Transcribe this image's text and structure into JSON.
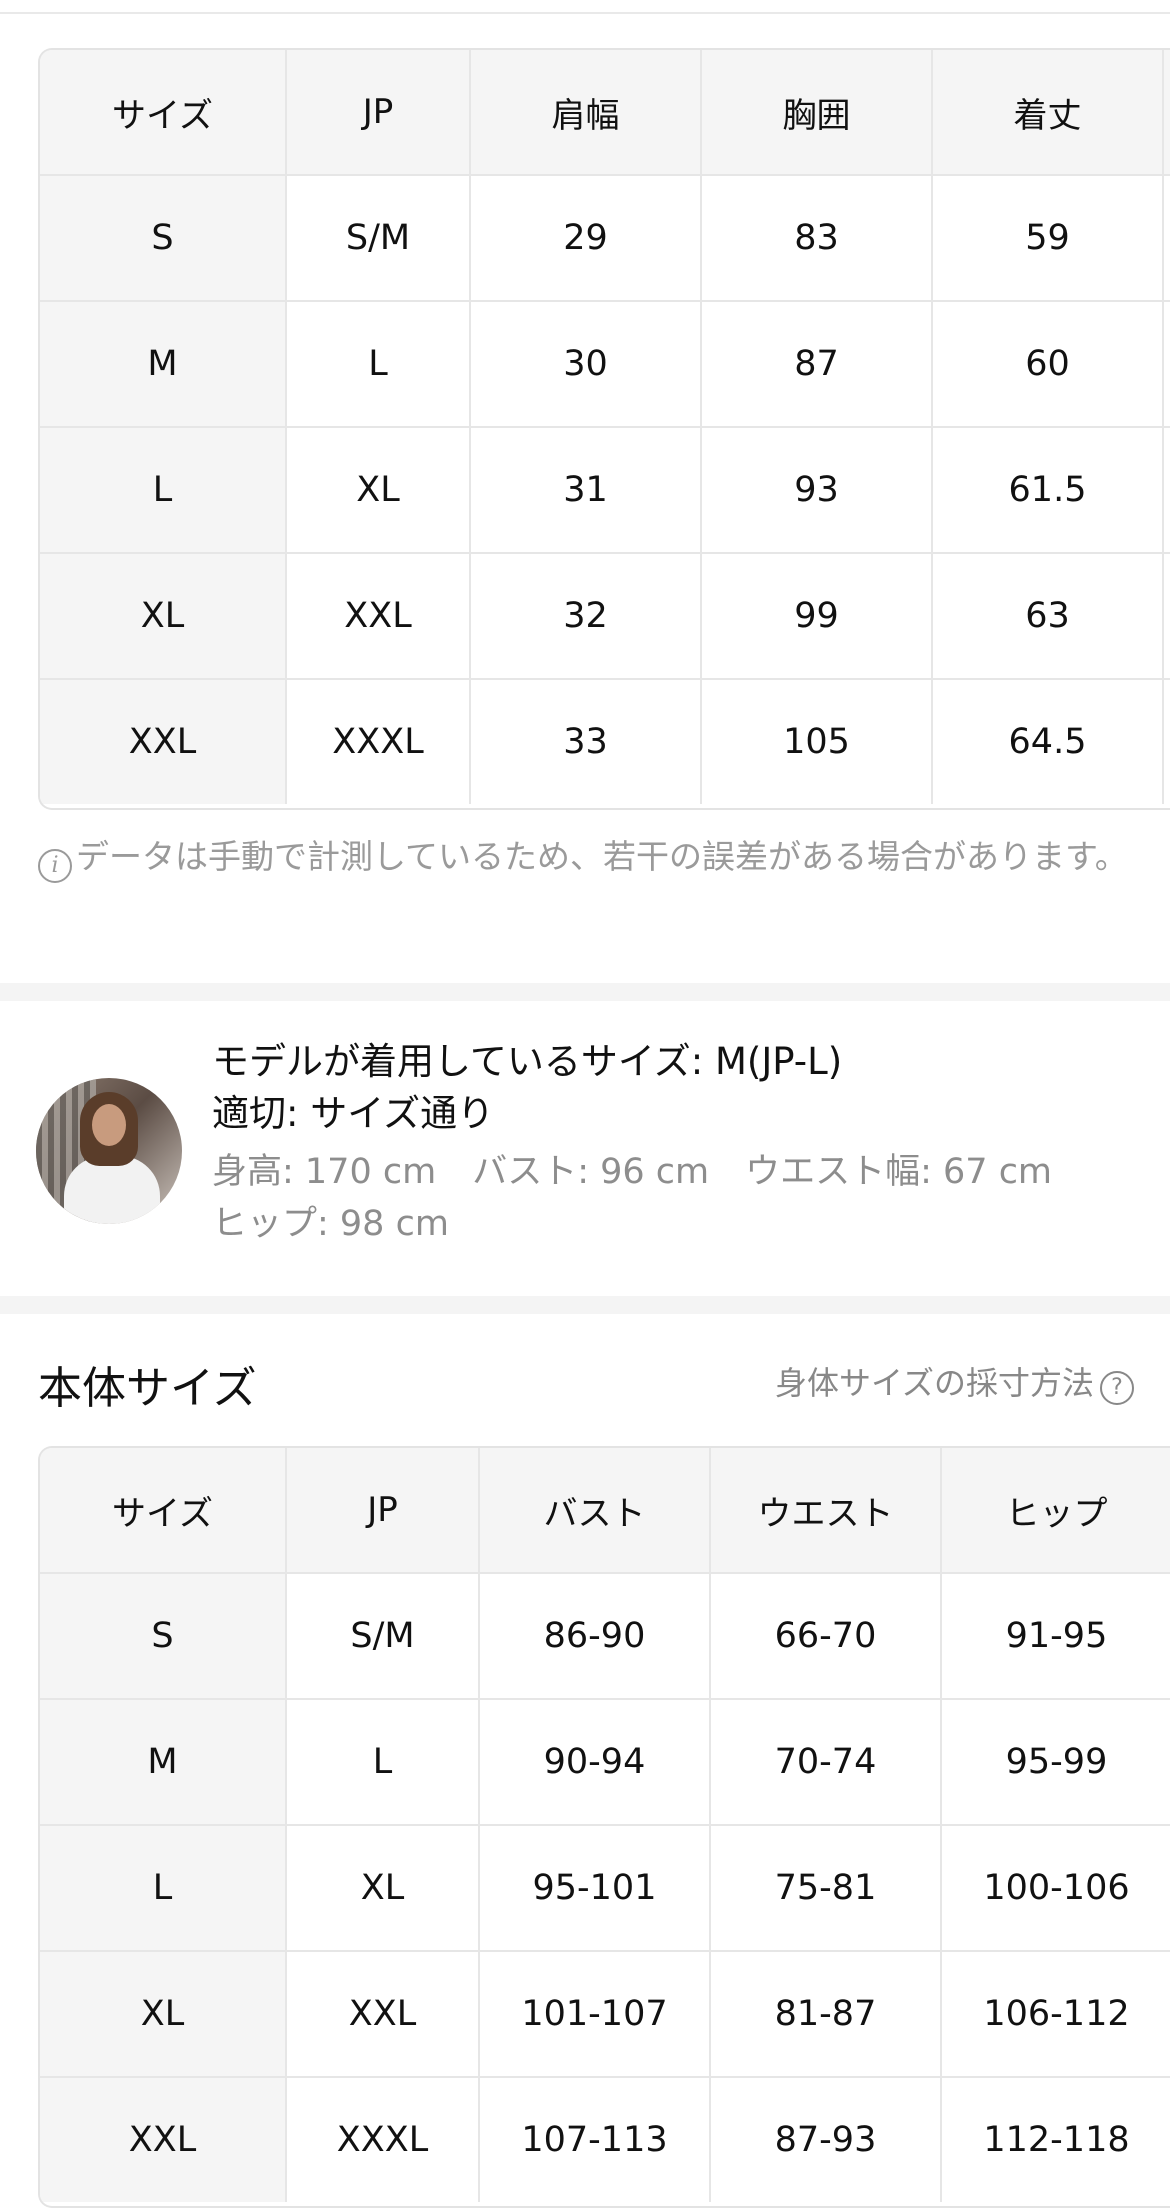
{
  "garment_table": {
    "headers": [
      "サイズ",
      "JP",
      "肩幅",
      "胸囲",
      "着丈"
    ],
    "rows": [
      [
        "S",
        "S/M",
        "29",
        "83",
        "59"
      ],
      [
        "M",
        "L",
        "30",
        "87",
        "60"
      ],
      [
        "L",
        "XL",
        "31",
        "93",
        "61.5"
      ],
      [
        "XL",
        "XXL",
        "32",
        "99",
        "63"
      ],
      [
        "XXL",
        "XXXL",
        "33",
        "105",
        "64.5"
      ]
    ]
  },
  "note": {
    "icon": "info-icon",
    "text": "データは手動で計測しているため、若干の誤差がある場合があります。"
  },
  "model": {
    "size_worn": "モデルが着用しているサイズ: M(JP-L)",
    "fit": "適切: サイズ通り",
    "height": "身高: 170 cm",
    "bust": "バスト: 96 cm",
    "waist": "ウエスト幅: 67 cm",
    "hip": "ヒップ: 98 cm"
  },
  "body_section": {
    "title": "本体サイズ",
    "measure_link": "身体サイズの採寸方法",
    "help_icon": "?"
  },
  "body_table": {
    "headers": [
      "サイズ",
      "JP",
      "バスト",
      "ウエスト",
      "ヒップ"
    ],
    "rows": [
      [
        "S",
        "S/M",
        "86-90",
        "66-70",
        "91-95"
      ],
      [
        "M",
        "L",
        "90-94",
        "70-74",
        "95-99"
      ],
      [
        "L",
        "XL",
        "95-101",
        "75-81",
        "100-106"
      ],
      [
        "XL",
        "XXL",
        "101-107",
        "81-87",
        "106-112"
      ],
      [
        "XXL",
        "XXXL",
        "107-113",
        "87-93",
        "112-118"
      ]
    ]
  }
}
